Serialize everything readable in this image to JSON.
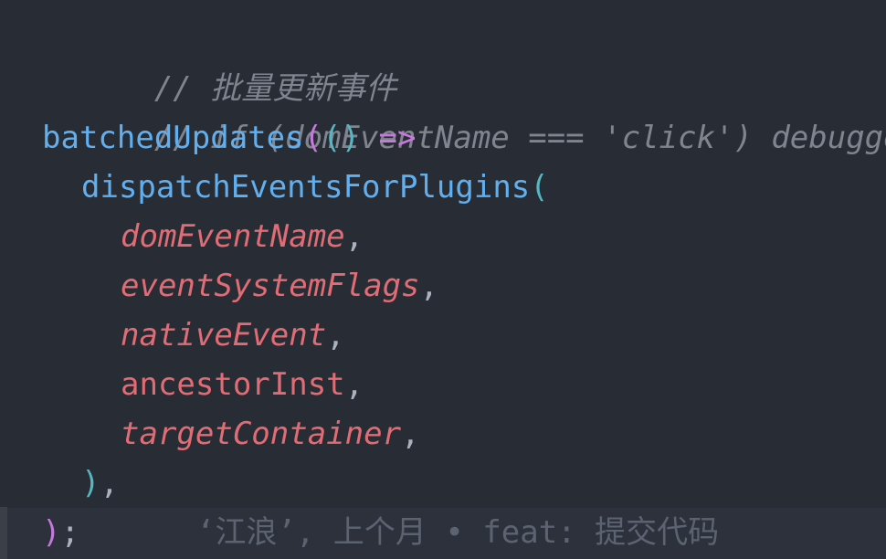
{
  "editor": {
    "lines": [
      {
        "comment": "// 批量更新事件"
      },
      {
        "comment": "// if (domEventName === 'click') debugger"
      },
      {
        "fn": "batchedUpdates",
        "open": "(",
        "args": "()",
        "arrow": "=>"
      },
      {
        "fn": "dispatchEventsForPlugins",
        "open": "("
      },
      {
        "param": "domEventName",
        "comma": ","
      },
      {
        "param": "eventSystemFlags",
        "comma": ","
      },
      {
        "param": "nativeEvent",
        "comma": ","
      },
      {
        "param": "ancestorInst",
        "comma": ","
      },
      {
        "param": "targetContainer",
        "comma": ","
      },
      {
        "close": ")",
        "comma": ","
      },
      {
        "close": ")",
        "semi": ";"
      }
    ],
    "blame": "‘江浪’, 上个月 • feat: 提交代码"
  }
}
